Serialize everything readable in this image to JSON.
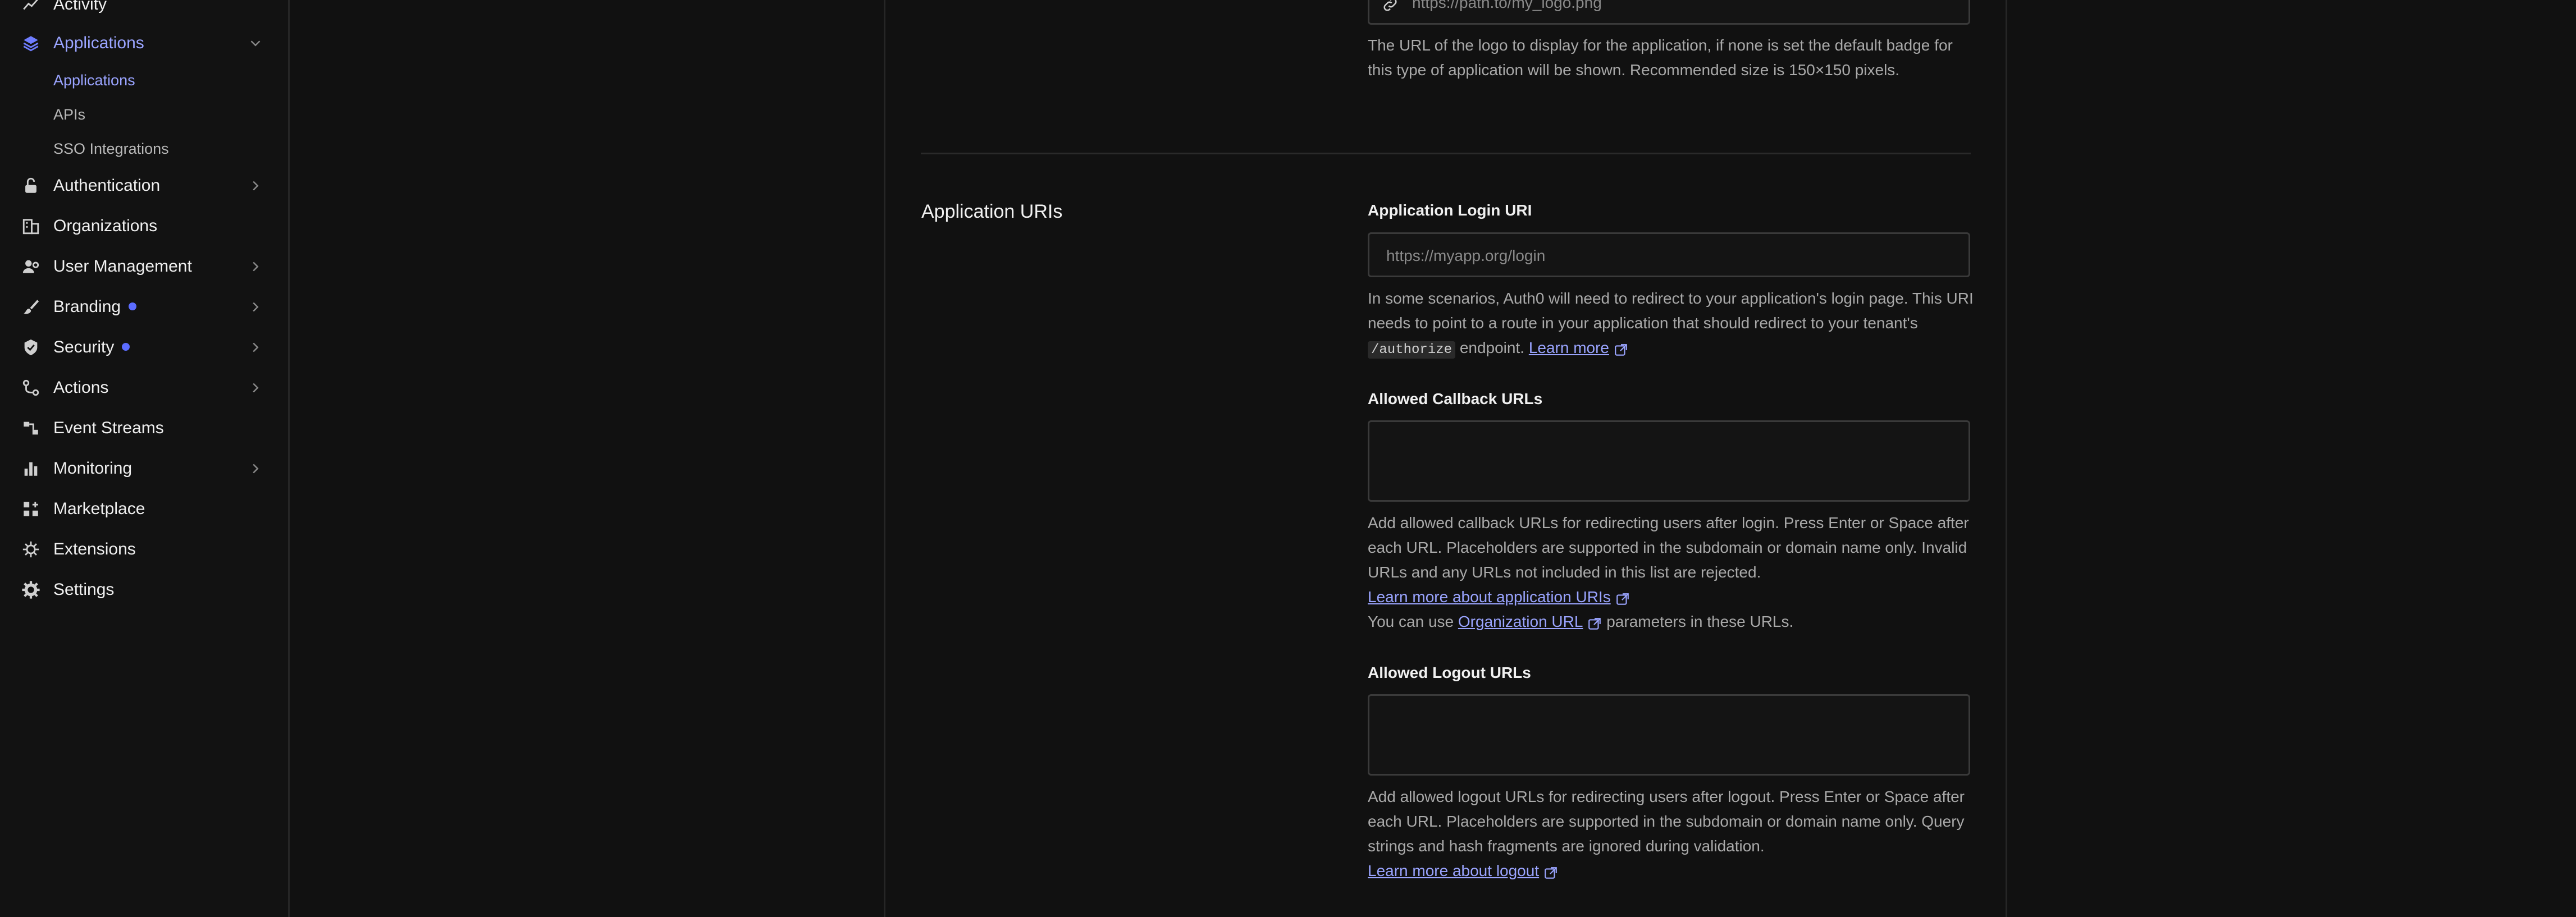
{
  "sidebar": {
    "items": [
      {
        "label": "Activity",
        "icon": "activity-icon"
      },
      {
        "label": "Applications",
        "icon": "applications-icon"
      },
      {
        "label": "Authentication",
        "icon": "lock-icon"
      },
      {
        "label": "Organizations",
        "icon": "building-icon"
      },
      {
        "label": "User Management",
        "icon": "users-icon"
      },
      {
        "label": "Branding",
        "icon": "brush-icon"
      },
      {
        "label": "Security",
        "icon": "shield-icon"
      },
      {
        "label": "Actions",
        "icon": "actions-icon"
      },
      {
        "label": "Event Streams",
        "icon": "event-streams-icon"
      },
      {
        "label": "Monitoring",
        "icon": "bar-chart-icon"
      },
      {
        "label": "Marketplace",
        "icon": "marketplace-icon"
      },
      {
        "label": "Extensions",
        "icon": "extensions-icon"
      },
      {
        "label": "Settings",
        "icon": "gear-icon"
      }
    ],
    "sub_items": [
      {
        "label": "Applications"
      },
      {
        "label": "APIs"
      },
      {
        "label": "SSO Integrations"
      }
    ]
  },
  "logo_section": {
    "input_placeholder": "https://path.to/my_logo.png",
    "help_text": "The URL of the logo to display for the application, if none is set the default badge for this type of application will be shown. Recommended size is 150×150 pixels."
  },
  "application_uris": {
    "section_title": "Application URIs",
    "login_uri": {
      "label": "Application Login URI",
      "placeholder": "https://myapp.org/login",
      "help_pre": "In some scenarios, Auth0 will need to redirect to your application's login page. This URI needs to point to a route in your application that should redirect to your tenant's",
      "help_code": "/authorize",
      "help_post": "endpoint.",
      "learn_more": "Learn more"
    },
    "callback": {
      "label": "Allowed Callback URLs",
      "value": "",
      "help": "Add allowed callback URLs for redirecting users after login. Press Enter or Space after each URL. Placeholders are supported in the subdomain or domain name only. Invalid URLs and any URLs not included in this list are rejected.",
      "learn_more": "Learn more about application URIs",
      "org_pre": "You can use",
      "org_link": "Organization URL",
      "org_post": "parameters in these URLs."
    },
    "logout": {
      "label": "Allowed Logout URLs",
      "value": "",
      "help": "Add allowed logout URLs for redirecting users after logout. Press Enter or Space after each URL. Placeholders are supported in the subdomain or domain name only. Query strings and hash fragments are ignored during validation.",
      "learn_more": "Learn more about logout"
    }
  },
  "colors": {
    "accent": "#9aa4ff",
    "badge_dot": "#5b6cff",
    "background": "#111111"
  }
}
